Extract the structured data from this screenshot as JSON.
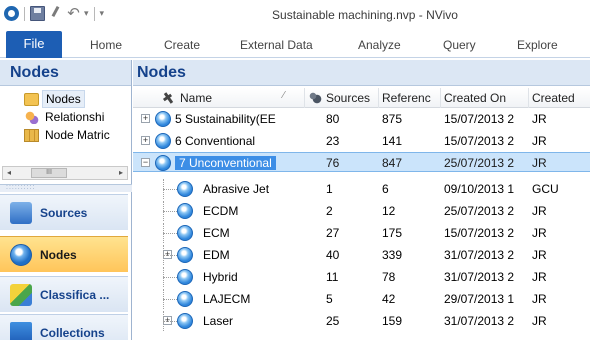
{
  "window": {
    "title": "Sustainable machining.nvp - NVivo"
  },
  "qat": {
    "logo_icon": "nvivo-logo-icon",
    "save_icon": "save-icon",
    "undo_icon": "undo-icon",
    "dropdown_glyph": "▾",
    "undo_glyph": "↶"
  },
  "ribbon": {
    "file_label": "File",
    "tabs": [
      "Home",
      "Create",
      "External Data",
      "Analyze",
      "Query",
      "Explore"
    ]
  },
  "nav": {
    "title": "Nodes",
    "tree": [
      {
        "label": "Nodes",
        "icon": "folder-icon",
        "selected": true
      },
      {
        "label": "Relationshi",
        "icon": "relationships-icon",
        "selected": false
      },
      {
        "label": "Node Matric",
        "icon": "node-matrices-icon",
        "selected": false
      }
    ],
    "scroll_thumb_glyph": "III",
    "scroll_left_glyph": "◂",
    "scroll_right_glyph": "▸",
    "grip_glyph": "::::::::::",
    "buttons": [
      {
        "label": "Sources",
        "icon": "sources-icon",
        "active": false
      },
      {
        "label": "Nodes",
        "icon": "nodes-icon",
        "active": true
      },
      {
        "label": "Classifica ...",
        "icon": "classifications-icon",
        "active": false
      },
      {
        "label": "Collections",
        "icon": "collections-icon",
        "active": false
      }
    ]
  },
  "main": {
    "title": "Nodes",
    "columns": [
      "Name",
      "Sources",
      "Referenc",
      "Created On",
      "Created"
    ],
    "sort_glyph": "⁄",
    "rows": [
      {
        "name": "5 Sustainability(EE",
        "sources": "80",
        "references": "875",
        "created_on": "15/07/2013 2",
        "created_by": "JR",
        "level": 0,
        "expander": "+",
        "selected": false
      },
      {
        "name": "6 Conventional",
        "sources": "23",
        "references": "141",
        "created_on": "15/07/2013 2",
        "created_by": "JR",
        "level": 0,
        "expander": "+",
        "selected": false
      },
      {
        "name": "7 Unconventional",
        "sources": "76",
        "references": "847",
        "created_on": "25/07/2013 2",
        "created_by": "JR",
        "level": 0,
        "expander": "−",
        "selected": true
      },
      {
        "name": "Abrasive Jet",
        "sources": "1",
        "references": "6",
        "created_on": "09/10/2013 1",
        "created_by": "GCU",
        "level": 1,
        "expander": "",
        "selected": false
      },
      {
        "name": "ECDM",
        "sources": "2",
        "references": "12",
        "created_on": "25/07/2013 2",
        "created_by": "JR",
        "level": 1,
        "expander": "",
        "selected": false
      },
      {
        "name": "ECM",
        "sources": "27",
        "references": "175",
        "created_on": "15/07/2013 2",
        "created_by": "JR",
        "level": 1,
        "expander": "",
        "selected": false
      },
      {
        "name": "EDM",
        "sources": "40",
        "references": "339",
        "created_on": "31/07/2013 2",
        "created_by": "JR",
        "level": 1,
        "expander": "+",
        "selected": false
      },
      {
        "name": "Hybrid",
        "sources": "11",
        "references": "78",
        "created_on": "31/07/2013 2",
        "created_by": "JR",
        "level": 1,
        "expander": "",
        "selected": false
      },
      {
        "name": "LAJECM",
        "sources": "5",
        "references": "42",
        "created_on": "29/07/2013 1",
        "created_by": "JR",
        "level": 1,
        "expander": "",
        "selected": false
      },
      {
        "name": "Laser",
        "sources": "25",
        "references": "159",
        "created_on": "31/07/2013 2",
        "created_by": "JR",
        "level": 1,
        "expander": "+",
        "selected": false
      }
    ]
  }
}
